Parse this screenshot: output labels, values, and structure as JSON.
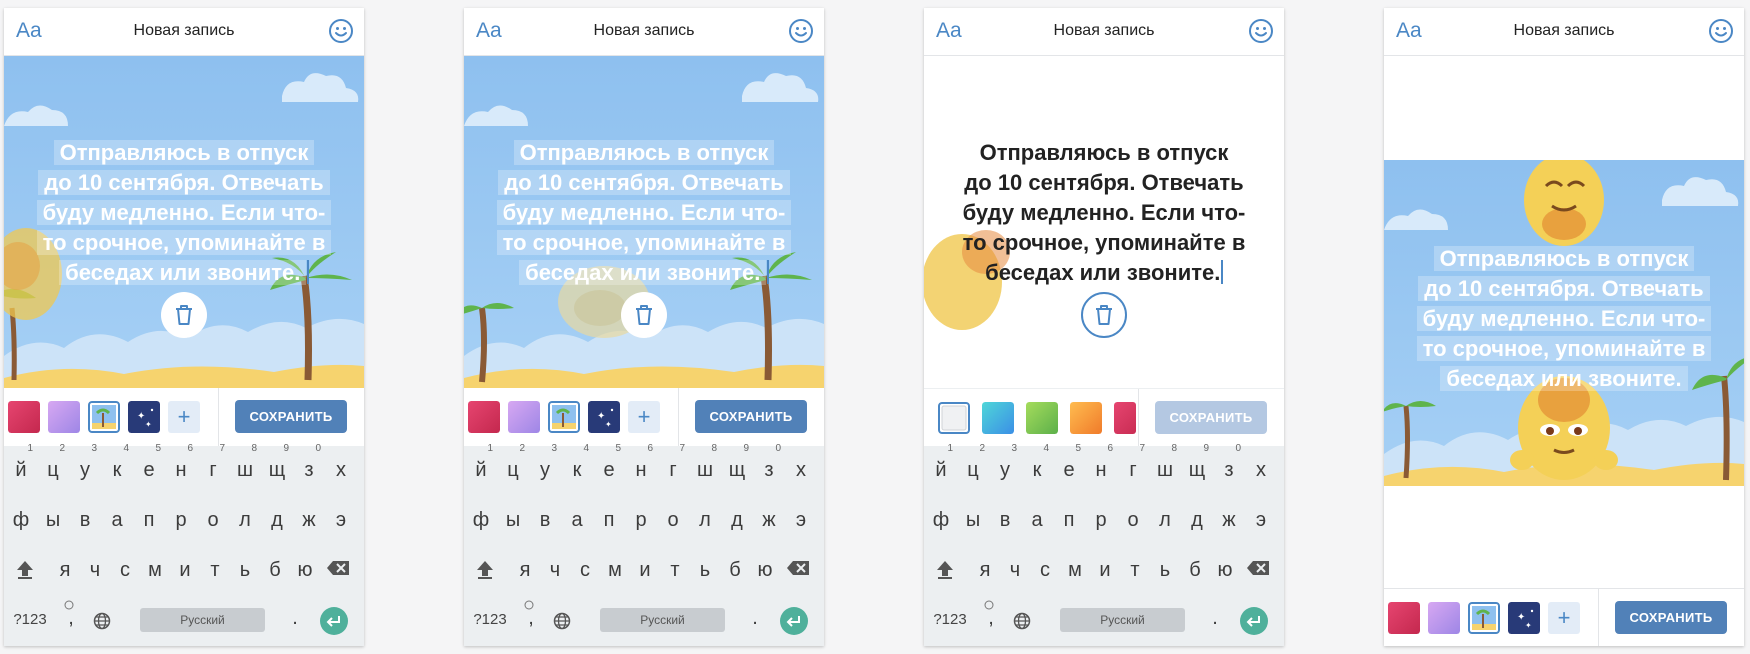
{
  "screens": [
    {
      "title": "Новая запись",
      "save_label": "СОХРАНИТЬ"
    },
    {
      "title": "Новая запись",
      "save_label": "СОХРАНИТЬ"
    },
    {
      "title": "Новая запись",
      "save_label": "СОХРАНИТЬ"
    },
    {
      "title": "Новая запись",
      "save_label": "СОХРАНИТЬ"
    }
  ],
  "post": {
    "text_lines": [
      "Отправляюсь в отпуск",
      "до 10 сентября. Отвечать",
      "буду медленно. Если что-",
      "то срочное, упоминайте в",
      "беседах или звоните."
    ]
  },
  "toolbar": {
    "font_toggle_label": "Aa",
    "add_label": "+"
  },
  "keyboard": {
    "row1": [
      "й",
      "ц",
      "у",
      "к",
      "е",
      "н",
      "г",
      "ш",
      "щ",
      "з",
      "х"
    ],
    "row1_digits": [
      "1",
      "2",
      "3",
      "4",
      "5",
      "6",
      "7",
      "8",
      "9",
      "0"
    ],
    "row2": [
      "ф",
      "ы",
      "в",
      "а",
      "п",
      "р",
      "о",
      "л",
      "д",
      "ж",
      "э"
    ],
    "row3": [
      "я",
      "ч",
      "с",
      "м",
      "и",
      "т",
      "ь",
      "б",
      "ю"
    ],
    "symbols_label": "?123",
    "comma_label": ",",
    "period_label": ".",
    "space_label": "Русский"
  },
  "icons": {
    "emoji": "smiley-face-icon",
    "trash": "trash-icon",
    "shift": "shift-arrow-icon",
    "backspace": "backspace-icon",
    "globe": "globe-icon",
    "enter": "enter-arrow-icon",
    "emoji_key": "emoji-key-icon"
  },
  "colors": {
    "accent": "#5181b8",
    "accent_icon": "#4a87c5",
    "save_disabled": "#b4c8e2",
    "sky": "#8ec0ef",
    "enter_key": "#4fb09b"
  }
}
